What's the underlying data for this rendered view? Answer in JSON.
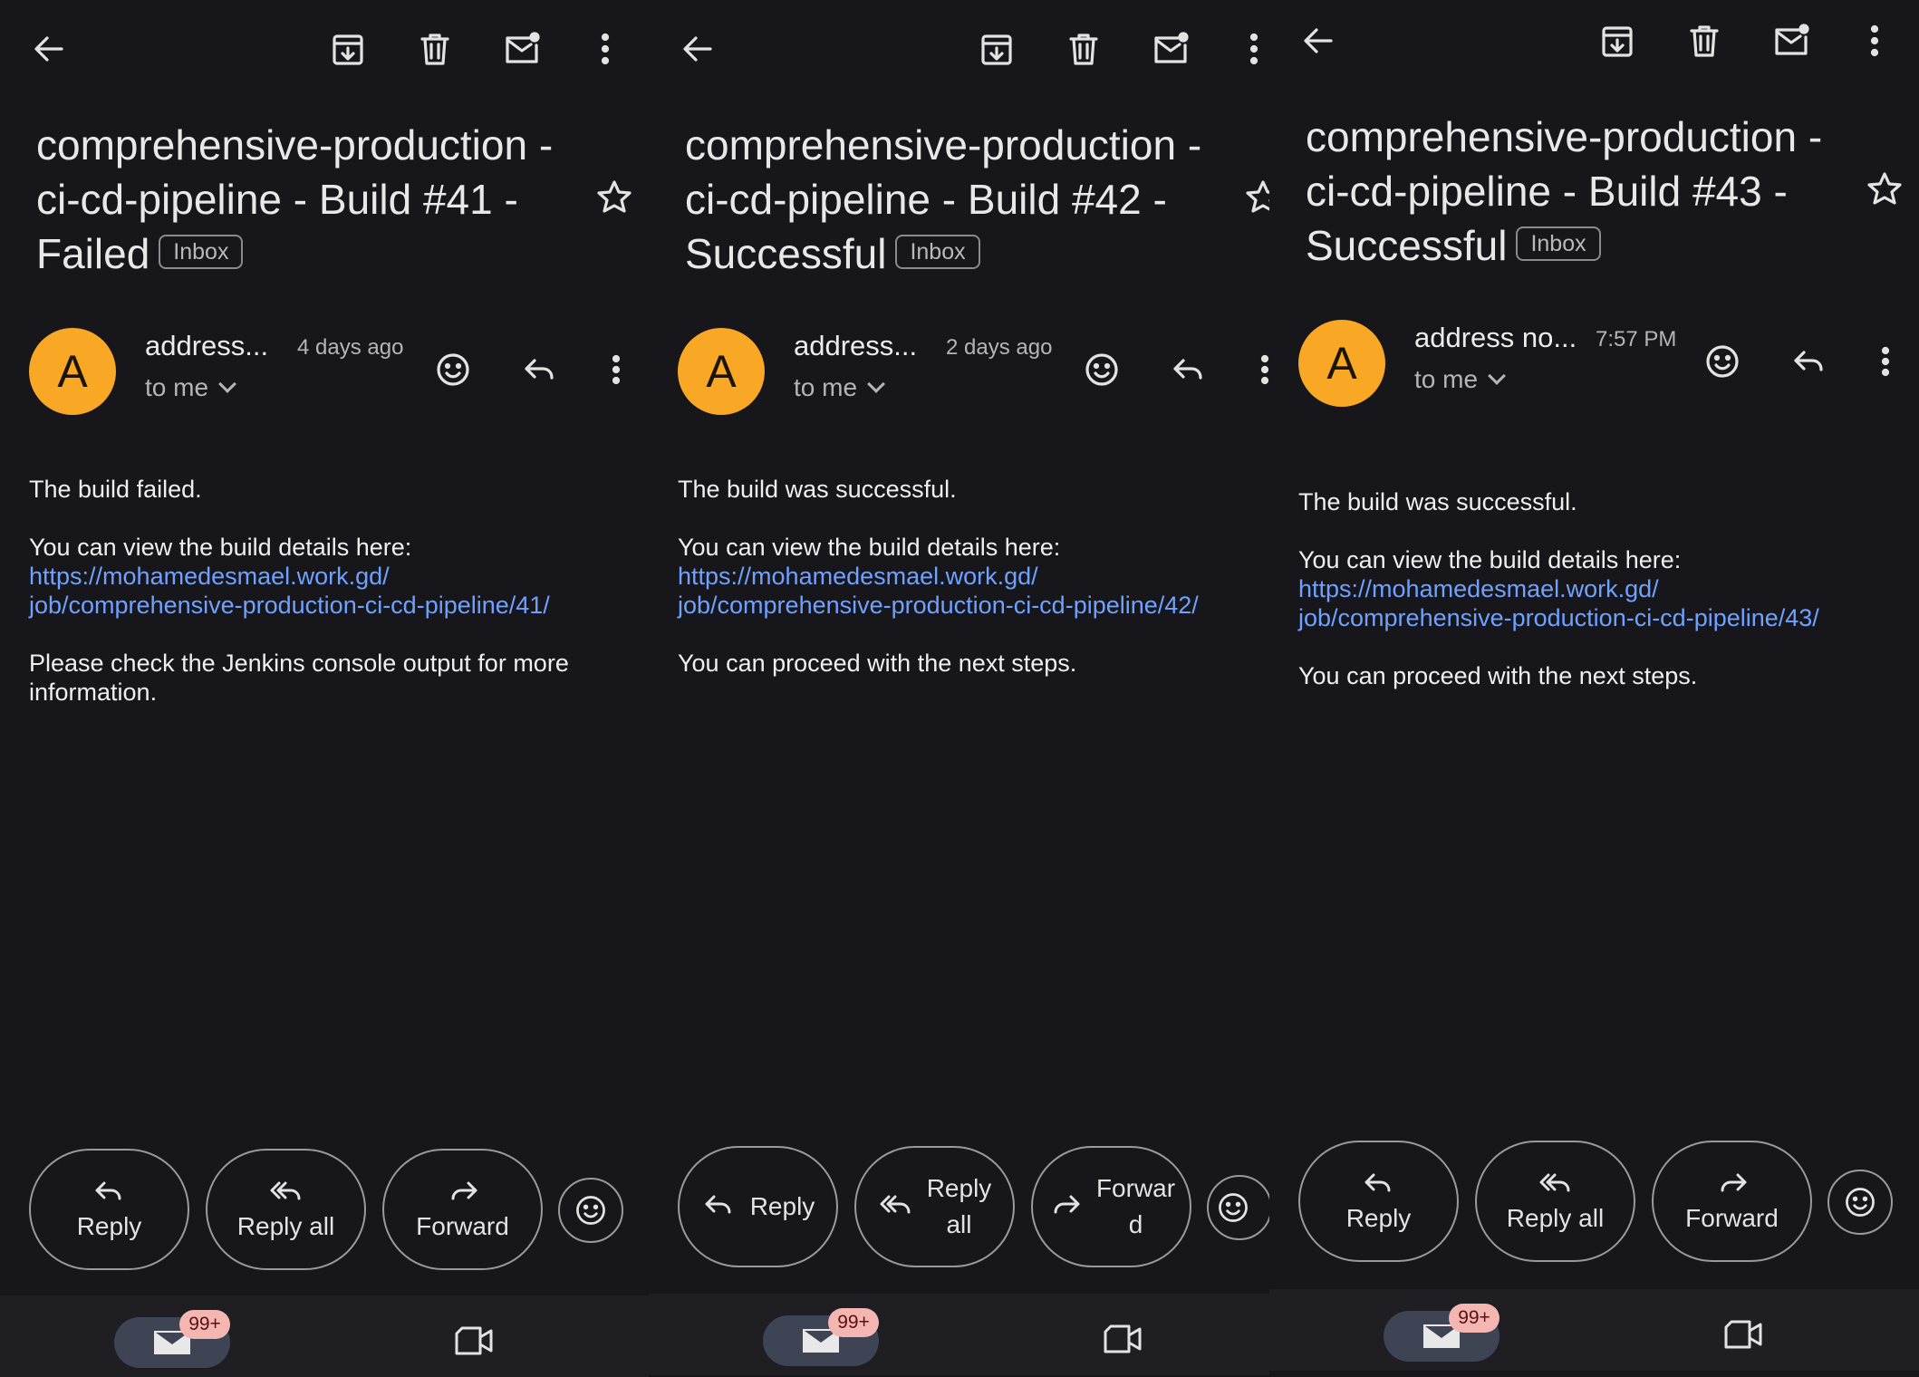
{
  "badge_label": "Inbox",
  "to_label": "to me",
  "avatar_letter": "A",
  "notification_count": "99+",
  "icons": [
    "back-arrow-icon",
    "archive-icon",
    "delete-icon",
    "mark-unread-icon",
    "more-vert-icon",
    "star-icon",
    "emoji-icon",
    "reply-icon",
    "reply-all-icon",
    "forward-icon",
    "mail-icon",
    "video-icon",
    "chevron-down-icon"
  ],
  "colors": {
    "avatar": "#f9a825",
    "link": "#6fa1ff",
    "background": "#17171b",
    "badge": "#f4b6b0"
  },
  "panels": [
    {
      "subject": "comprehensive-production -ci-cd-pipeline - Build #41 - Failed",
      "sender": "address...",
      "time": "4 days ago",
      "lines": [
        "The build failed.",
        "You can view the build details here:",
        "Please check the Jenkins console output for more information."
      ],
      "link1": "https://mohamedesmael.work.gd/",
      "link2": "job/comprehensive-production-ci-cd-pipeline/41/",
      "actions": {
        "reply": "Reply",
        "reply_all": "Reply all",
        "forward": "Forward"
      }
    },
    {
      "subject": "comprehensive-production -ci-cd-pipeline - Build #42 - Successful",
      "sender": "address...",
      "time": "2 days ago",
      "lines": [
        "The build was successful.",
        "You can view the build details here:",
        "You can proceed with the next steps."
      ],
      "link1": "https://mohamedesmael.work.gd/",
      "link2": "job/comprehensive-production-ci-cd-pipeline/42/",
      "actions": {
        "reply": "Reply",
        "reply_all_1": "Reply",
        "reply_all_2": "all",
        "forward_1": "Forwar",
        "forward_2": "d"
      }
    },
    {
      "subject": "comprehensive-production -ci-cd-pipeline - Build #43 - Successful",
      "sender": "address no...",
      "time": "7:57 PM",
      "lines": [
        "The build was successful.",
        "You can view the build details here:",
        "You can proceed with the next steps."
      ],
      "link1": "https://mohamedesmael.work.gd/",
      "link2": "job/comprehensive-production-ci-cd-pipeline/43/",
      "actions": {
        "reply": "Reply",
        "reply_all": "Reply all",
        "forward": "Forward"
      }
    }
  ]
}
